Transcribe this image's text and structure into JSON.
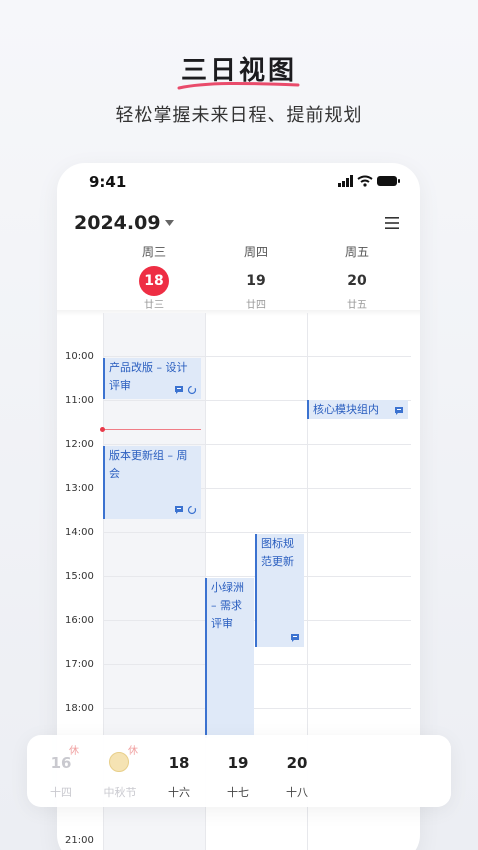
{
  "hero": {
    "title": "三日视图",
    "subtitle": "轻松掌握未来日程、提前规划"
  },
  "status": {
    "time": "9:41",
    "icons": [
      "signal-icon",
      "wifi-icon",
      "battery-icon"
    ]
  },
  "header": {
    "month": "2024.09",
    "menu_icon": "menu-icon"
  },
  "days": [
    {
      "week": "周三",
      "num": "18",
      "lunar": "廿三",
      "today": true
    },
    {
      "week": "周四",
      "num": "19",
      "lunar": "廿四",
      "today": false
    },
    {
      "week": "周五",
      "num": "20",
      "lunar": "廿五",
      "today": false
    }
  ],
  "hours": [
    "10:00",
    "11:00",
    "12:00",
    "13:00",
    "14:00",
    "15:00",
    "16:00",
    "17:00",
    "18:00",
    "21:00"
  ],
  "events": [
    {
      "title": "产品改版 – 设计评审",
      "day": 0,
      "icons": [
        "note-icon",
        "repeat-icon"
      ]
    },
    {
      "title": "版本更新组 – 周会",
      "day": 0,
      "icons": [
        "note-icon",
        "repeat-icon"
      ]
    },
    {
      "title": "核心模块组内",
      "day": 2,
      "icons": [
        "note-icon"
      ]
    },
    {
      "title": "图标规范更新",
      "day": 1,
      "icons": [
        "note-icon"
      ]
    },
    {
      "title": "小绿洲 – 需求评审",
      "day": 1,
      "icons": []
    }
  ],
  "dock": [
    {
      "num": "16",
      "sub": "十四",
      "badge": "休",
      "faded": true
    },
    {
      "num": "",
      "sub": "中秋节",
      "badge": "休",
      "faded": true,
      "icon": "moon-icon"
    },
    {
      "num": "18",
      "sub": "十六",
      "badge": "",
      "faded": false
    },
    {
      "num": "19",
      "sub": "十七",
      "badge": "",
      "faded": false
    },
    {
      "num": "20",
      "sub": "十八",
      "badge": "",
      "faded": false
    }
  ],
  "colors": {
    "accent": "#ee2e44",
    "event_bg": "#dfe9f8",
    "event_border": "#3b72d0",
    "event_text": "#2a5ebf"
  }
}
